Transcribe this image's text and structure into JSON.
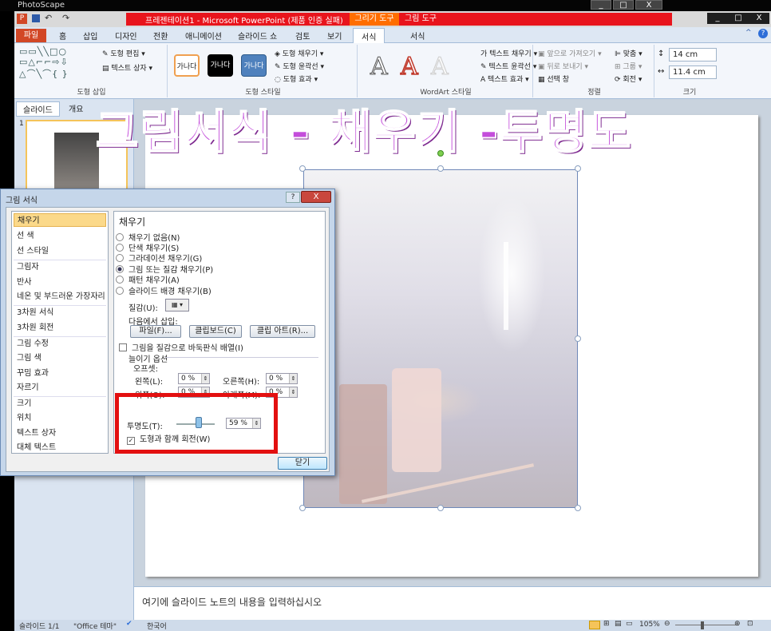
{
  "photoscape": {
    "title": "PhotoScape",
    "controls": [
      "_",
      "□",
      "X"
    ]
  },
  "powerpoint": {
    "title": "프레젠테이션1 - Microsoft PowerPoint (제품 인증 실패)",
    "context_draw": "그리기 도구",
    "context_picture": "그림 도구",
    "window_controls": [
      "_",
      "□",
      "X"
    ],
    "tabs": [
      "파일",
      "홈",
      "삽입",
      "디자인",
      "전환",
      "애니메이션",
      "슬라이드 쇼",
      "검토",
      "보기",
      "서식",
      "서식"
    ],
    "help": "?",
    "ribbon": {
      "shape_insert": {
        "label": "도형 삽입",
        "edit": "도형 편집",
        "textbox": "텍스트 상자"
      },
      "shape_styles": {
        "label": "도형 스타일",
        "samples": [
          "가나다",
          "가나다",
          "가나다"
        ],
        "fill": "도형 채우기",
        "outline": "도형 윤곽선",
        "effects": "도형 효과"
      },
      "wordart": {
        "label": "WordArt 스타일",
        "samples": [
          "A",
          "A",
          "A"
        ],
        "text_fill": "텍스트 채우기",
        "text_outline": "텍스트 윤곽선",
        "text_effects": "텍스트 효과"
      },
      "arrange": {
        "label": "정렬",
        "forward": "앞으로 가져오기",
        "backward": "뒤로 보내기",
        "selection": "선택 창",
        "align": "맞춤",
        "group": "그룹",
        "rotate": "회전"
      },
      "size": {
        "label": "크기",
        "height": "14 cm",
        "width": "11.4 cm"
      }
    },
    "left_pane": {
      "tabs": [
        "슬라이드",
        "개요"
      ],
      "slide_number": "1"
    },
    "slide": {
      "heading": "그림서식 - 채우기 -투명도"
    },
    "notes_placeholder": "여기에 슬라이드 노트의 내용을 입력하십시오",
    "status": {
      "slide": "슬라이드 1/1",
      "theme": "\"Office 테마\"",
      "language": "한국어",
      "zoom": "105%"
    }
  },
  "dialog": {
    "title": "그림 서식",
    "close": "X",
    "help": "?",
    "categories": [
      "채우기",
      "선 색",
      "선 스타일",
      "그림자",
      "반사",
      "네온 및 부드러운 가장자리",
      "3차원 서식",
      "3차원 회전",
      "그림 수정",
      "그림 색",
      "꾸밈 효과",
      "자르기",
      "크기",
      "위치",
      "텍스트 상자",
      "대체 텍스트"
    ],
    "selected_category": "채우기",
    "pane_title": "채우기",
    "fill_options": [
      {
        "label": "채우기 없음(N)",
        "selected": false
      },
      {
        "label": "단색 채우기(S)",
        "selected": false
      },
      {
        "label": "그라데이션 채우기(G)",
        "selected": false
      },
      {
        "label": "그림 또는 질감 채우기(P)",
        "selected": true
      },
      {
        "label": "패턴 채우기(A)",
        "selected": false
      },
      {
        "label": "슬라이드 배경 채우기(B)",
        "selected": false
      }
    ],
    "texture_label": "질감(U):",
    "insert_from": "다음에서 삽입:",
    "file_button": "파일(F)...",
    "clipboard_button": "클립보드(C)",
    "clipart_button": "클립 아트(R)...",
    "tile_checkbox": "그림을 질감으로 바둑판식 배열(I)",
    "stretch_options": "늘이기 옵션",
    "offset_label": "오프셋:",
    "left_label": "왼쪽(L):",
    "left_value": "0 %",
    "right_label": "오른쪽(H):",
    "right_value": "0 %",
    "top_label": "위쪽(O):",
    "top_value": "0 %",
    "bottom_label": "아래쪽(M):",
    "bottom_value": "0 %",
    "transparency_label": "투명도(T):",
    "transparency_value": "59 %",
    "transparency_fraction": 0.59,
    "rotate_checkbox": "도형과 함께 회전(W)",
    "close_button": "닫기"
  },
  "colors": {
    "highlight": "#e31010",
    "heading": "#c44ddb",
    "file_tab": "#d24726"
  }
}
